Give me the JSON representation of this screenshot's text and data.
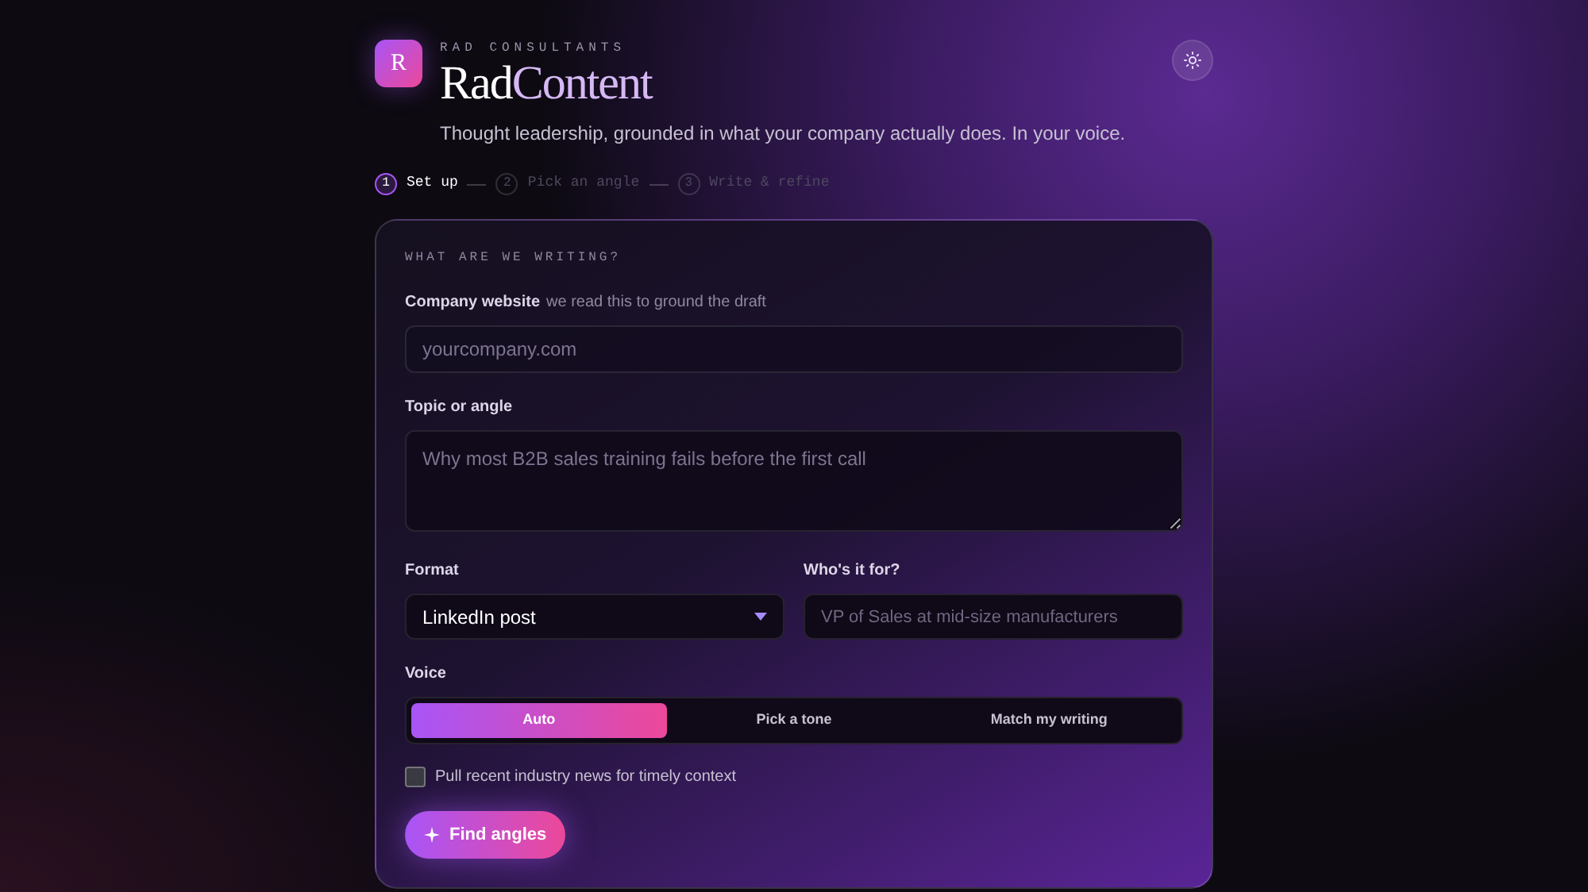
{
  "header": {
    "logo_letter": "R",
    "eyebrow": "RAD CONSULTANTS",
    "title_main": "Rad",
    "title_accent": "Content",
    "tagline": "Thought leadership, grounded in what your company actually does. In your voice."
  },
  "steps": [
    {
      "number": "1",
      "label": "Set up",
      "selected": true
    },
    {
      "number": "2",
      "label": "Pick an angle",
      "selected": false
    },
    {
      "number": "3",
      "label": "Write & refine",
      "selected": false
    }
  ],
  "form": {
    "heading": "WHAT ARE WE WRITING?",
    "website": {
      "label": "Company website",
      "hint": "we read this to ground the draft",
      "placeholder": "yourcompany.com"
    },
    "topic": {
      "label": "Topic or angle",
      "placeholder": "Why most B2B sales training fails before the first call"
    },
    "format": {
      "label": "Format",
      "value": "LinkedIn post"
    },
    "audience": {
      "label": "Who's it for?",
      "placeholder": "VP of Sales at mid-size manufacturers"
    },
    "voice": {
      "label": "Voice",
      "options": [
        {
          "label": "Auto",
          "selected": true
        },
        {
          "label": "Pick a tone",
          "selected": false
        },
        {
          "label": "Match my writing",
          "selected": false
        }
      ]
    },
    "news": {
      "label": "Pull recent industry news for timely context",
      "checked": false
    },
    "submit": "Find angles"
  }
}
